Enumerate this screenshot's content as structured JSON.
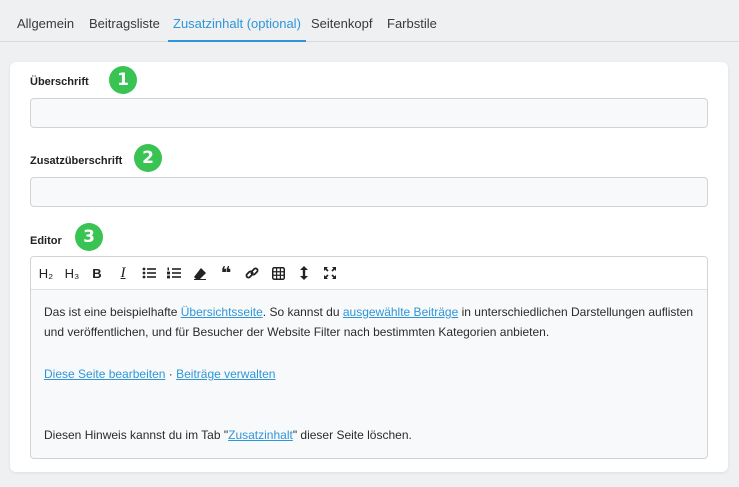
{
  "tabs": [
    {
      "label": "Allgemein"
    },
    {
      "label": "Beitragsliste"
    },
    {
      "label": "Zusatzinhalt (optional)",
      "active": true
    },
    {
      "label": "Seitenkopf"
    },
    {
      "label": "Farbstile"
    }
  ],
  "fields": {
    "heading": {
      "label": "Überschrift",
      "badge": "1",
      "value": ""
    },
    "subheading": {
      "label": "Zusatzüberschrift",
      "badge": "2",
      "value": ""
    },
    "editor": {
      "label": "Editor",
      "badge": "3"
    }
  },
  "toolbar": {
    "h2": "H₂",
    "h3": "H₃",
    "bold": "B",
    "italic": "I",
    "icons": [
      "heading-2-icon",
      "heading-3-icon",
      "bold-icon",
      "italic-icon",
      "bullet-list-icon",
      "numbered-list-icon",
      "eraser-icon",
      "quote-icon",
      "link-icon",
      "table-icon",
      "line-height-icon",
      "fullscreen-icon"
    ]
  },
  "content": {
    "p1": {
      "t1": "Das ist eine beispielhafte ",
      "link1": "Übersichtsseite",
      "t2": ". So kannst du ",
      "link2": "ausgewählte Beiträge",
      "t3": " in unterschiedlichen Darstellungen auflisten",
      "t4": "und veröffentlichen, und für Besucher der Website Filter nach bestimmten Kategorien anbieten."
    },
    "p2": {
      "link1": "Diese Seite bearbeiten",
      "sep": " · ",
      "link2": "Beiträge verwalten"
    },
    "p3": {
      "t1": "Diesen Hinweis kannst du im Tab \"",
      "link": "Zusatzinhalt",
      "t2": "\" dieser Seite löschen."
    }
  },
  "colors": {
    "accent": "#2e96d8",
    "badge": "#39c353"
  }
}
